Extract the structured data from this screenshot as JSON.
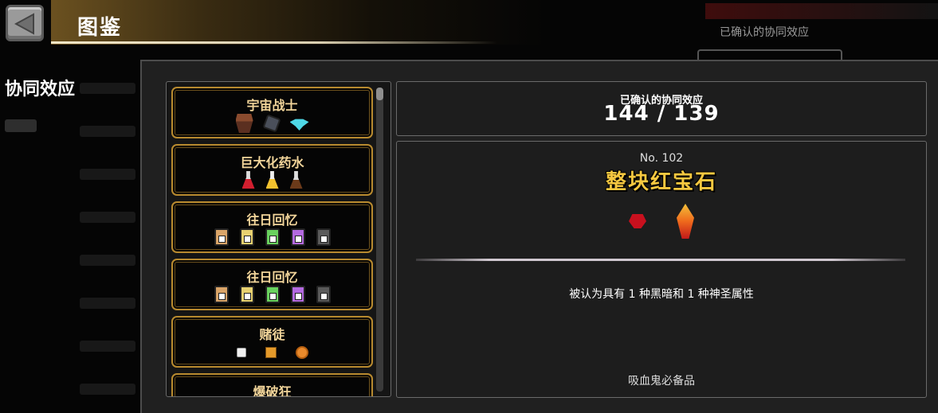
{
  "header": {
    "title": "图鉴",
    "back_icon": "back-arrow-icon"
  },
  "background_hint": {
    "text": "已确认的协同效应"
  },
  "sidebar": {
    "active": "协同效应"
  },
  "synergy_list": [
    {
      "title": "宇宙战士",
      "icons": [
        "armor-icon",
        "stone-icon",
        "drone-icon"
      ]
    },
    {
      "title": "巨大化药水",
      "icons": [
        "red-potion-icon",
        "gold-potion-icon",
        "dark-potion-icon"
      ]
    },
    {
      "title": "往日回忆",
      "icons": [
        "book-i-icon",
        "book-ii-icon",
        "book-iii-icon",
        "book-iv-icon",
        "book-v-icon"
      ]
    },
    {
      "title": "往日回忆",
      "icons": [
        "book-i-icon",
        "book-ii-icon",
        "book-iii-icon",
        "book-iv-icon",
        "book-v-icon"
      ]
    },
    {
      "title": "赌徒",
      "icons": [
        "dice-icon",
        "chip-icon",
        "coin-icon"
      ]
    },
    {
      "title": "爆破狂",
      "icons": []
    }
  ],
  "counter": {
    "label": "已确认的协同效应",
    "value": "144 / 139"
  },
  "detail": {
    "number": "No. 102",
    "name": "整块红宝石",
    "items": [
      "small-ruby-icon",
      "large-ruby-icon"
    ],
    "description": "被认为具有 1 种黑暗和 1 种神圣属性",
    "flavor": "吸血鬼必备品"
  },
  "colors": {
    "card_border": "#b88a2f",
    "card_title": "#f2d59a",
    "detail_name": "#f6c840"
  }
}
